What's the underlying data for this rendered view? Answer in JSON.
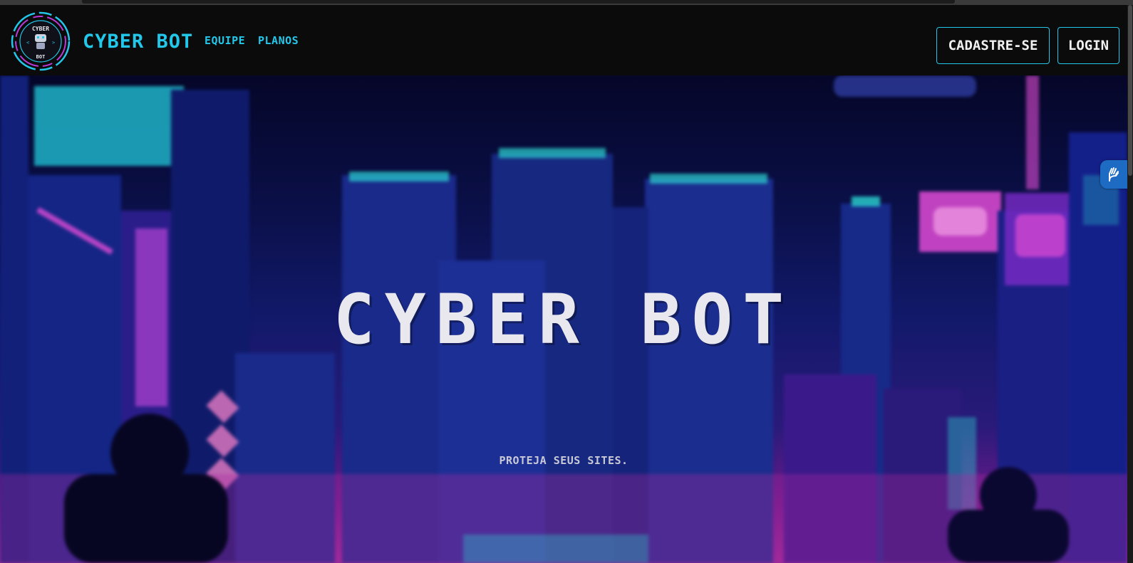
{
  "browser": {
    "tab_visible": true
  },
  "header": {
    "logo_text_top": "CYBER",
    "logo_text_bottom": "BOT",
    "brand": "CYBER BOT",
    "nav": [
      {
        "label": "EQUIPE"
      },
      {
        "label": "PLANOS"
      }
    ],
    "signup_label": "CADASTRE-SE",
    "login_label": "LOGIN"
  },
  "hero": {
    "title": "CYBER BOT",
    "subtitle": "PROTEJA SEUS SITES."
  },
  "accessibility_widget": {
    "icon": "hand-sign-language-icon"
  },
  "colors": {
    "accent": "#22c7ea",
    "header_bg": "#0b0b0b",
    "title": "#e8e8ee",
    "hero_top": "#050628",
    "hero_bottom": "#9a2a9a",
    "neon_pink": "#e04bd6",
    "neon_cyan": "#2bd3d0",
    "widget_blue": "#1e6bc4"
  }
}
